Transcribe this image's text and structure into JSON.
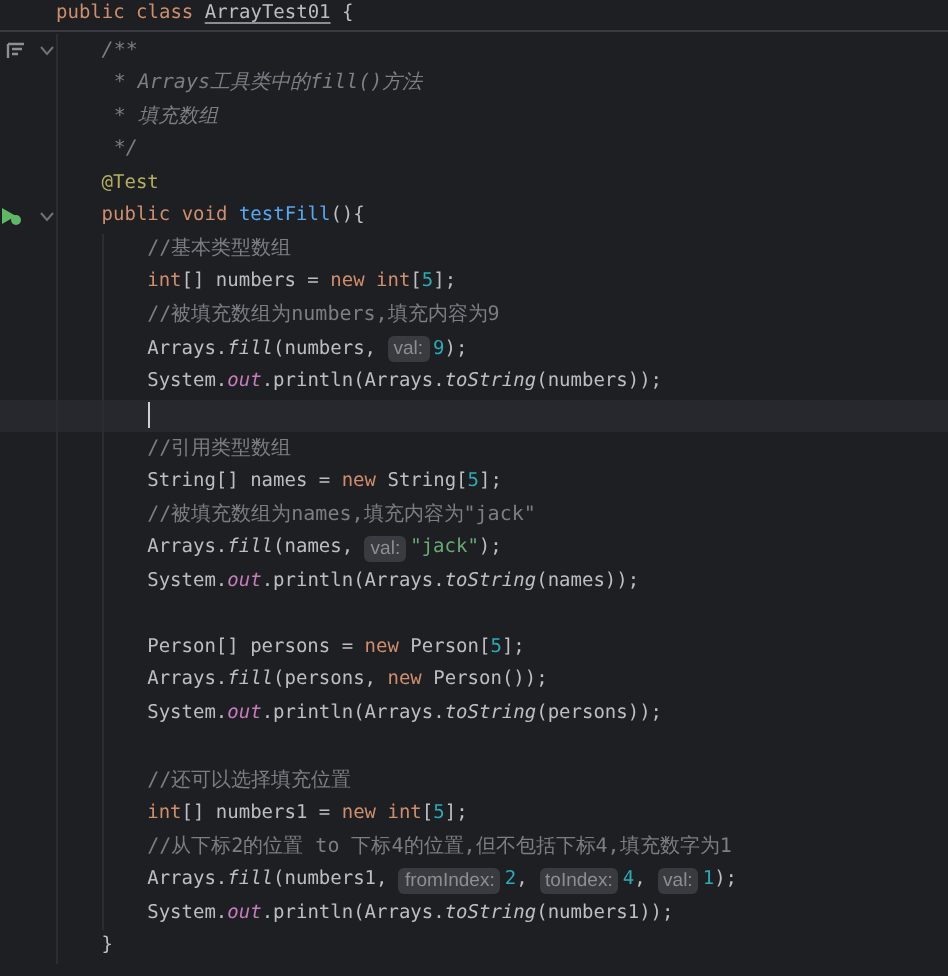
{
  "editor": {
    "lines": [
      {
        "tokens": [
          {
            "kind": "keyword",
            "text": "public class "
          },
          {
            "kind": "class_name",
            "text": "ArrayTest01"
          },
          {
            "kind": "plain",
            "text": " {"
          }
        ],
        "children": [
          {
            "gutter": {
              "kind": "doc"
            },
            "tokens": [
              {
                "kind": "doc",
                "text": "/**"
              }
            ]
          },
          {
            "tokens": [
              {
                "kind": "doc",
                "text": " * Arrays工具类中的fill()方法"
              }
            ]
          },
          {
            "tokens": [
              {
                "kind": "doc",
                "text": " * 填充数组"
              }
            ]
          },
          {
            "tokens": [
              {
                "kind": "doc",
                "text": " */"
              }
            ]
          },
          {
            "tokens": [
              {
                "kind": "annotation",
                "text": "@Test"
              }
            ]
          },
          {
            "gutter": {
              "kind": "run"
            },
            "tokens": [
              {
                "kind": "keyword",
                "text": "public void "
              },
              {
                "kind": "method_decl",
                "text": "testFill"
              },
              {
                "kind": "plain",
                "text": "(){"
              }
            ],
            "children": [
              {
                "tokens": [
                  {
                    "kind": "comment",
                    "text": "//基本类型数组"
                  }
                ]
              },
              {
                "tokens": [
                  {
                    "kind": "keyword",
                    "text": "int"
                  },
                  {
                    "kind": "plain",
                    "text": "[] numbers = "
                  },
                  {
                    "kind": "keyword",
                    "text": "new int"
                  },
                  {
                    "kind": "plain",
                    "text": "["
                  },
                  {
                    "kind": "number",
                    "text": "5"
                  },
                  {
                    "kind": "plain",
                    "text": "];"
                  }
                ]
              },
              {
                "tokens": [
                  {
                    "kind": "comment",
                    "text": "//被填充数组为numbers,填充内容为9"
                  }
                ]
              },
              {
                "tokens": [
                  {
                    "kind": "plain",
                    "text": "Arrays."
                  },
                  {
                    "kind": "static_method",
                    "text": "fill"
                  },
                  {
                    "kind": "plain",
                    "text": "(numbers, "
                  },
                  {
                    "kind": "hint",
                    "text": "val:"
                  },
                  {
                    "kind": "number",
                    "text": "9"
                  },
                  {
                    "kind": "plain",
                    "text": ");"
                  }
                ]
              },
              {
                "tokens": [
                  {
                    "kind": "plain",
                    "text": "System."
                  },
                  {
                    "kind": "static_field",
                    "text": "out"
                  },
                  {
                    "kind": "plain",
                    "text": ".println(Arrays."
                  },
                  {
                    "kind": "static_method",
                    "text": "toString"
                  },
                  {
                    "kind": "plain",
                    "text": "(numbers));"
                  }
                ]
              },
              {
                "current": true
              },
              {
                "tokens": [
                  {
                    "kind": "comment",
                    "text": "//引用类型数组"
                  }
                ]
              },
              {
                "tokens": [
                  {
                    "kind": "plain",
                    "text": "String[] names = "
                  },
                  {
                    "kind": "keyword",
                    "text": "new"
                  },
                  {
                    "kind": "plain",
                    "text": " String["
                  },
                  {
                    "kind": "number",
                    "text": "5"
                  },
                  {
                    "kind": "plain",
                    "text": "];"
                  }
                ]
              },
              {
                "tokens": [
                  {
                    "kind": "comment",
                    "text": "//被填充数组为names,填充内容为\"jack\""
                  }
                ]
              },
              {
                "tokens": [
                  {
                    "kind": "plain",
                    "text": "Arrays."
                  },
                  {
                    "kind": "static_method",
                    "text": "fill"
                  },
                  {
                    "kind": "plain",
                    "text": "(names, "
                  },
                  {
                    "kind": "hint",
                    "text": "val:"
                  },
                  {
                    "kind": "string",
                    "text": "\"jack\""
                  },
                  {
                    "kind": "plain",
                    "text": ");"
                  }
                ]
              },
              {
                "tokens": [
                  {
                    "kind": "plain",
                    "text": "System."
                  },
                  {
                    "kind": "static_field",
                    "text": "out"
                  },
                  {
                    "kind": "plain",
                    "text": ".println(Arrays."
                  },
                  {
                    "kind": "static_method",
                    "text": "toString"
                  },
                  {
                    "kind": "plain",
                    "text": "(names));"
                  }
                ]
              },
              {
                "blank": true
              },
              {
                "tokens": [
                  {
                    "kind": "plain",
                    "text": "Person[] persons = "
                  },
                  {
                    "kind": "keyword",
                    "text": "new"
                  },
                  {
                    "kind": "plain",
                    "text": " Person["
                  },
                  {
                    "kind": "number",
                    "text": "5"
                  },
                  {
                    "kind": "plain",
                    "text": "];"
                  }
                ]
              },
              {
                "tokens": [
                  {
                    "kind": "plain",
                    "text": "Arrays."
                  },
                  {
                    "kind": "static_method",
                    "text": "fill"
                  },
                  {
                    "kind": "plain",
                    "text": "(persons, "
                  },
                  {
                    "kind": "keyword",
                    "text": "new"
                  },
                  {
                    "kind": "plain",
                    "text": " Person());"
                  }
                ]
              },
              {
                "tokens": [
                  {
                    "kind": "plain",
                    "text": "System."
                  },
                  {
                    "kind": "static_field",
                    "text": "out"
                  },
                  {
                    "kind": "plain",
                    "text": ".println(Arrays."
                  },
                  {
                    "kind": "static_method",
                    "text": "toString"
                  },
                  {
                    "kind": "plain",
                    "text": "(persons));"
                  }
                ]
              },
              {
                "blank": true
              },
              {
                "tokens": [
                  {
                    "kind": "comment",
                    "text": "//还可以选择填充位置"
                  }
                ]
              },
              {
                "tokens": [
                  {
                    "kind": "keyword",
                    "text": "int"
                  },
                  {
                    "kind": "plain",
                    "text": "[] numbers1 = "
                  },
                  {
                    "kind": "keyword",
                    "text": "new int"
                  },
                  {
                    "kind": "plain",
                    "text": "["
                  },
                  {
                    "kind": "number",
                    "text": "5"
                  },
                  {
                    "kind": "plain",
                    "text": "];"
                  }
                ]
              },
              {
                "tokens": [
                  {
                    "kind": "comment",
                    "text": "//从下标2的位置 to 下标4的位置,但不包括下标4,填充数字为1"
                  }
                ]
              },
              {
                "tokens": [
                  {
                    "kind": "plain",
                    "text": "Arrays."
                  },
                  {
                    "kind": "static_method",
                    "text": "fill"
                  },
                  {
                    "kind": "plain",
                    "text": "(numbers1, "
                  },
                  {
                    "kind": "hint",
                    "text": "fromIndex:"
                  },
                  {
                    "kind": "number",
                    "text": "2"
                  },
                  {
                    "kind": "plain",
                    "text": ", "
                  },
                  {
                    "kind": "hint",
                    "text": "toIndex:"
                  },
                  {
                    "kind": "number",
                    "text": "4"
                  },
                  {
                    "kind": "plain",
                    "text": ", "
                  },
                  {
                    "kind": "hint",
                    "text": "val:"
                  },
                  {
                    "kind": "number",
                    "text": "1"
                  },
                  {
                    "kind": "plain",
                    "text": ");"
                  }
                ]
              },
              {
                "tokens": [
                  {
                    "kind": "plain",
                    "text": "System."
                  },
                  {
                    "kind": "static_field",
                    "text": "out"
                  },
                  {
                    "kind": "plain",
                    "text": ".println(Arrays."
                  },
                  {
                    "kind": "static_method",
                    "text": "toString"
                  },
                  {
                    "kind": "plain",
                    "text": "(numbers1));"
                  }
                ]
              }
            ]
          },
          {
            "tokens": [
              {
                "kind": "plain",
                "text": "}"
              }
            ]
          }
        ]
      }
    ]
  }
}
